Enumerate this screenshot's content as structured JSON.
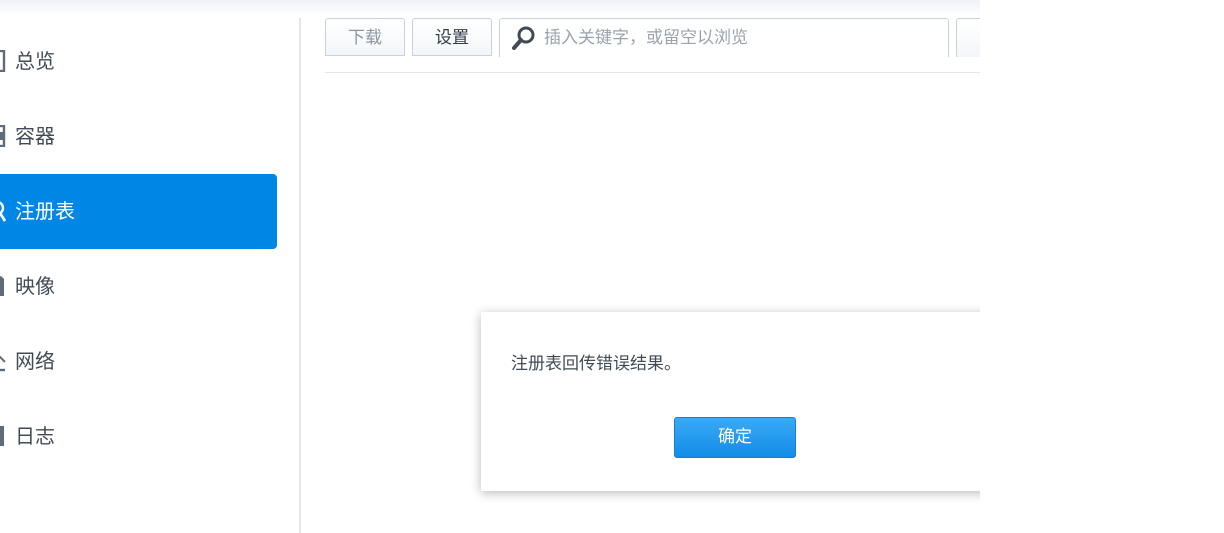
{
  "sidebar": {
    "items": [
      {
        "label": "总览",
        "icon": "overview-icon",
        "active": false
      },
      {
        "label": "容器",
        "icon": "container-icon",
        "active": false
      },
      {
        "label": "注册表",
        "icon": "registry-icon",
        "active": true
      },
      {
        "label": "映像",
        "icon": "image-icon",
        "active": false
      },
      {
        "label": "网络",
        "icon": "network-icon",
        "active": false
      },
      {
        "label": "日志",
        "icon": "log-icon",
        "active": false
      }
    ]
  },
  "toolbar": {
    "download_label": "下载",
    "settings_label": "设置",
    "search_placeholder": "插入关键字，或留空以浏览",
    "search_value": ""
  },
  "dialog": {
    "message": "注册表回传错误结果。",
    "ok_label": "确定"
  },
  "colors": {
    "accent": "#0086e5",
    "button_blue": "#1a8fe8"
  }
}
